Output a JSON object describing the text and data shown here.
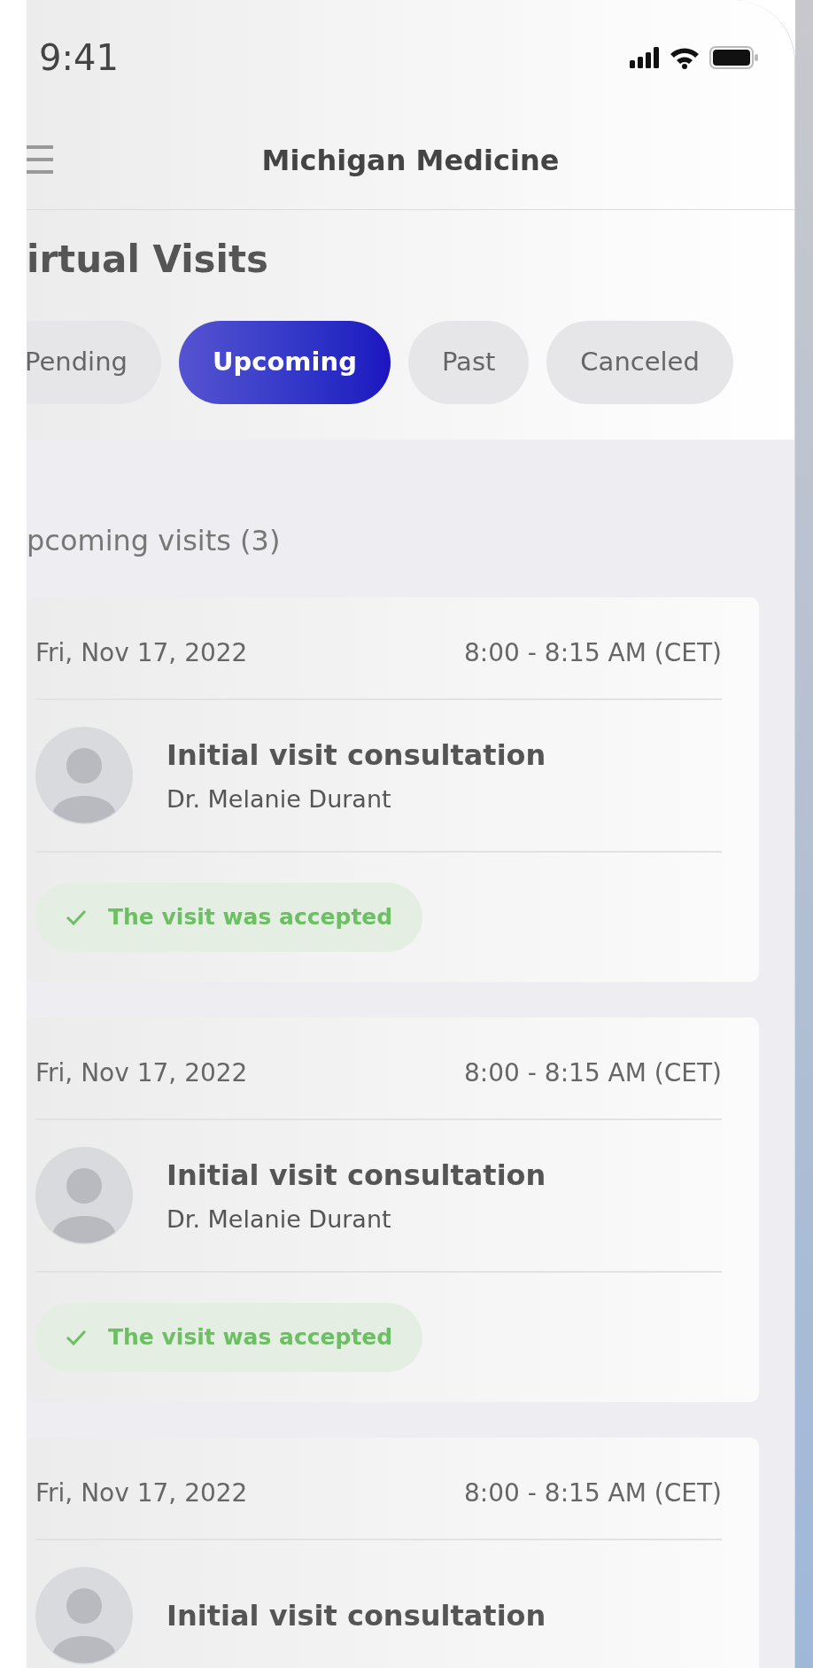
{
  "status_bar": {
    "time": "9:41"
  },
  "header": {
    "title": "Michigan Medicine"
  },
  "page_title": "irtual Visits",
  "tabs": [
    {
      "label": "Pending",
      "selected": false
    },
    {
      "label": "Upcoming",
      "selected": true
    },
    {
      "label": "Past",
      "selected": false
    },
    {
      "label": "Canceled",
      "selected": false
    }
  ],
  "section_title": "pcoming visits (3)",
  "visits": [
    {
      "date": "Fri, Nov 17, 2022",
      "time": "8:00 - 8:15 AM (CET)",
      "title": "Initial visit consultation",
      "doctor": "Dr. Melanie Durant",
      "status": "The visit was accepted"
    },
    {
      "date": "Fri, Nov 17, 2022",
      "time": "8:00 - 8:15 AM (CET)",
      "title": "Initial visit consultation",
      "doctor": "Dr. Melanie Durant",
      "status": "The visit was accepted"
    },
    {
      "date": "Fri, Nov 17, 2022",
      "time": "8:00 - 8:15 AM (CET)",
      "title": "Initial visit consultation"
    }
  ]
}
